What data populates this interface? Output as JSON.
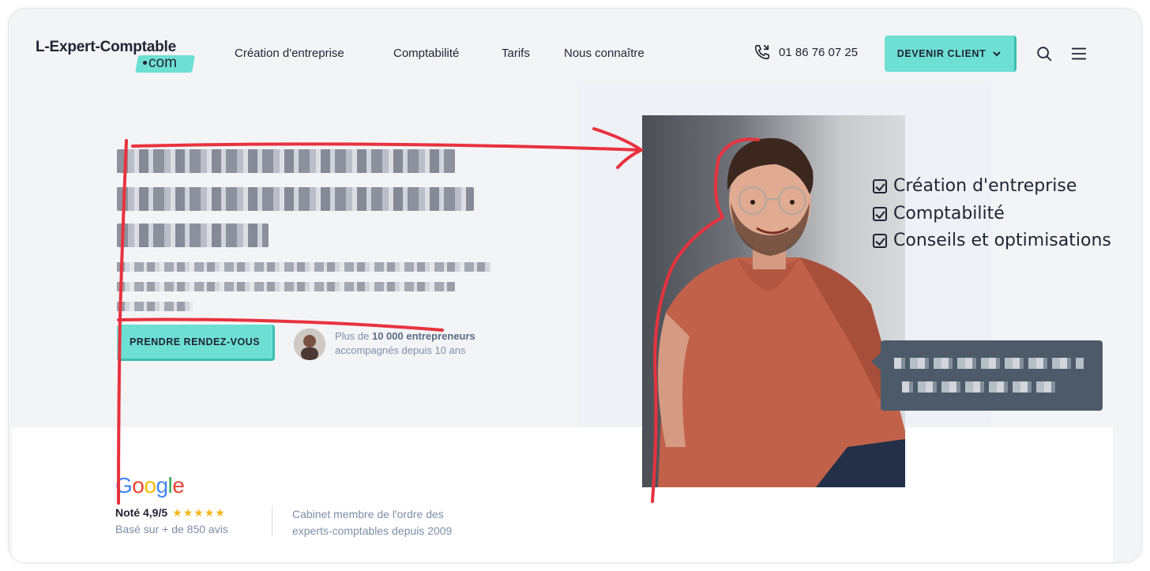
{
  "header": {
    "logo_main": "L-Expert-Comptable",
    "logo_com": "com",
    "nav": [
      "Création d'entreprise",
      "Comptabilité",
      "Tarifs",
      "Nous connaître"
    ],
    "phone": "01 86 76 07 25",
    "cta": "DEVENIR CLIENT",
    "icons": [
      "phone-icon",
      "chevron-down-icon",
      "search-icon",
      "menu-icon"
    ]
  },
  "hero": {
    "button": "PRENDRE RENDEZ-VOUS",
    "accomp_line1_pre": "Plus de ",
    "accomp_line1_bold": "10 000 entrepreneurs",
    "accomp_line2": "accompagnés depuis 10 ans",
    "checklist": [
      "Création d'entreprise",
      "Comptabilité",
      "Conseils et optimisations"
    ]
  },
  "reviews": {
    "brand": "Google",
    "rating": "Noté 4,9/5",
    "stars": "★★★★★",
    "based_on": "Basé sur + de 850 avis",
    "cabinet_line1": "Cabinet membre de l'ordre des",
    "cabinet_line2": "experts-comptables depuis 2009"
  },
  "colors": {
    "accent": "#6ee0d3",
    "text": "#1f2433",
    "muted": "#7d8fa8",
    "annotation": "#e8323e",
    "tooltip": "#4d5a69",
    "star": "#f5b51b"
  }
}
